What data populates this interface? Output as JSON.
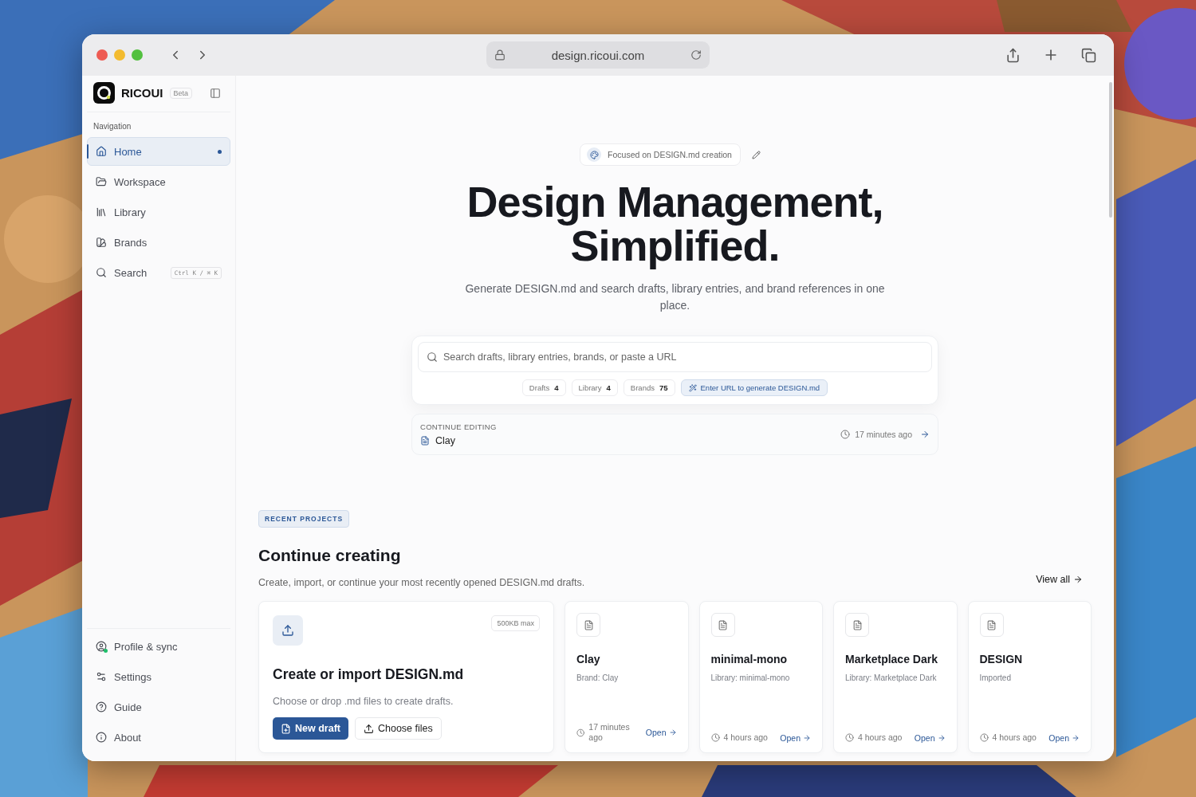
{
  "browser": {
    "url": "design.ricoui.com"
  },
  "sidebar": {
    "brand": "RICOUI",
    "brand_badge": "Beta",
    "section_label": "Navigation",
    "items": [
      {
        "kind": "home",
        "label": "Home",
        "selected": true
      },
      {
        "kind": "workspace",
        "label": "Workspace",
        "selected": false
      },
      {
        "kind": "library",
        "label": "Library",
        "selected": false
      },
      {
        "kind": "brands",
        "label": "Brands",
        "selected": false
      },
      {
        "kind": "search",
        "label": "Search",
        "selected": false,
        "shortcut": "Ctrl K / ⌘ K"
      }
    ],
    "footer_items": [
      {
        "kind": "profile",
        "label": "Profile & sync"
      },
      {
        "kind": "settings",
        "label": "Settings"
      },
      {
        "kind": "guide",
        "label": "Guide"
      },
      {
        "kind": "about",
        "label": "About"
      }
    ]
  },
  "hero": {
    "badge": "Focused on DESIGN.md creation",
    "title_lines": [
      "Design Management,",
      "Simplified."
    ],
    "subtitle": "Generate DESIGN.md and search drafts, library entries, and brand references in one place."
  },
  "search": {
    "placeholder": "Search drafts, library entries, brands, or paste a URL",
    "filters": [
      {
        "label": "Drafts",
        "count": "4"
      },
      {
        "label": "Library",
        "count": "4"
      },
      {
        "label": "Brands",
        "count": "75"
      }
    ],
    "action": "Enter URL to generate DESIGN.md"
  },
  "continue_editing": {
    "label": "CONTINUE EDITING",
    "item": "Clay",
    "time": "17 minutes ago"
  },
  "recent": {
    "tag": "RECENT PROJECTS",
    "heading": "Continue creating",
    "description": "Create, import, or continue your most recently opened DESIGN.md drafts.",
    "view_all": "View all",
    "import_card": {
      "size_limit": "500KB max",
      "title": "Create or import DESIGN.md",
      "text": "Choose or drop .md files to create drafts.",
      "primary_button": "New draft",
      "secondary_button": "Choose files"
    },
    "projects": [
      {
        "title": "Clay",
        "subtitle": "Brand: Clay",
        "time": "17 minutes ago",
        "action": "Open"
      },
      {
        "title": "minimal-mono",
        "subtitle": "Library: minimal-mono",
        "time": "4 hours ago",
        "action": "Open"
      },
      {
        "title": "Marketplace Dark",
        "subtitle": "Library: Marketplace Dark",
        "time": "4 hours ago",
        "action": "Open"
      },
      {
        "title": "DESIGN",
        "subtitle": "Imported",
        "time": "4 hours ago",
        "action": "Open"
      }
    ]
  }
}
